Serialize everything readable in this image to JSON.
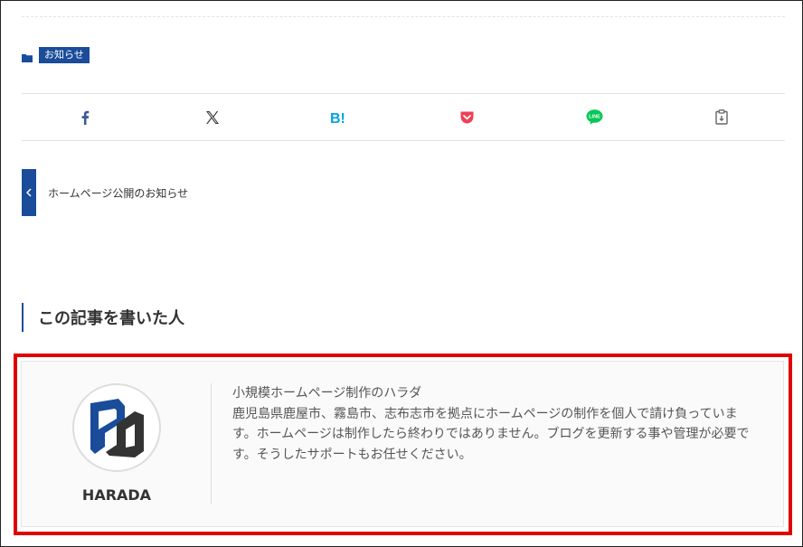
{
  "category": {
    "label": "お知らせ"
  },
  "share": [
    {
      "name": "facebook",
      "icon": "facebook-icon",
      "color": "#3b5998"
    },
    {
      "name": "x",
      "icon": "x-icon",
      "color": "#333333"
    },
    {
      "name": "hatena-bookmark",
      "icon": "hatena-bookmark-icon",
      "color": "#00a4de"
    },
    {
      "name": "pocket",
      "icon": "pocket-icon",
      "color": "#ef4056"
    },
    {
      "name": "line",
      "icon": "line-icon",
      "color": "#06c755"
    },
    {
      "name": "copy",
      "icon": "clipboard-icon",
      "color": "#666666"
    }
  ],
  "hatena_label": "B!",
  "line_label": "LINE",
  "prev_post": {
    "title": "ホームページ公開のお知らせ"
  },
  "author_section": {
    "heading": "この記事を書いた人"
  },
  "author": {
    "name": "HARADA",
    "tagline": "小規模ホームページ制作のハラダ",
    "bio": "鹿児島県鹿屋市、霧島市、志布志市を拠点にホームページの制作を個人で請け負っています。ホームページは制作したら終わりではありません。ブログを更新する事や管理が必要です。そうしたサポートもお任せください。"
  },
  "colors": {
    "accent": "#1a4c9a",
    "highlight": "#e00000"
  }
}
